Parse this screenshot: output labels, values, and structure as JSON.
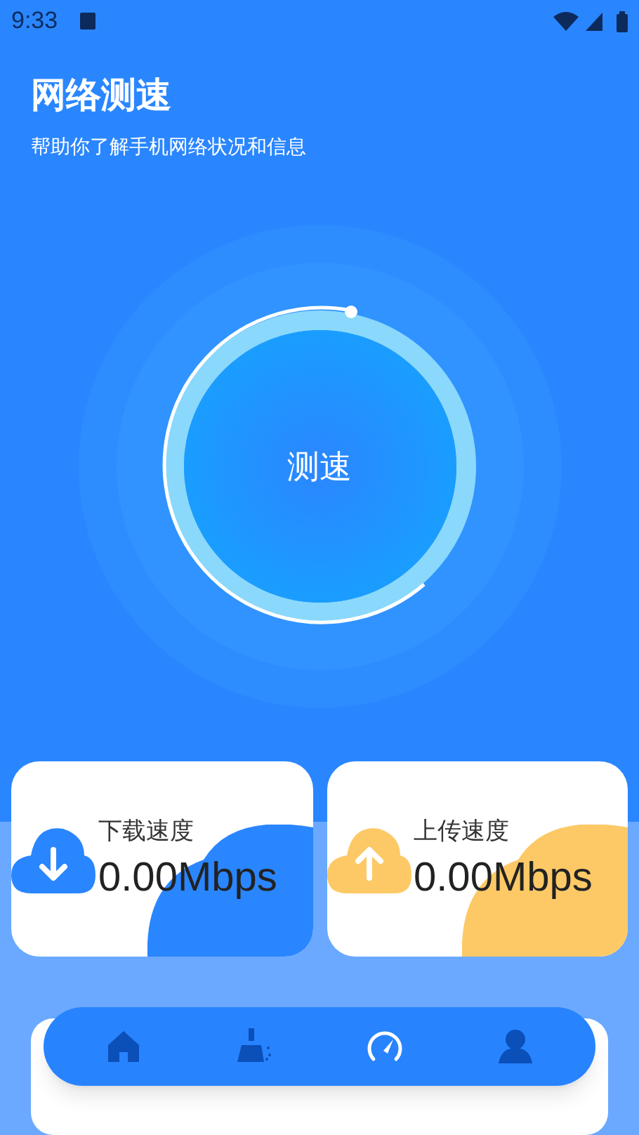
{
  "status_bar": {
    "time": "9:33"
  },
  "header": {
    "title": "网络测速",
    "subtitle": "帮助你了解手机网络状况和信息"
  },
  "test_button": {
    "label": "测速"
  },
  "cards": [
    {
      "kind": "download",
      "label": "下载速度",
      "value": "0.00Mbps"
    },
    {
      "kind": "upload",
      "label": "上传速度",
      "value": "0.00Mbps"
    }
  ],
  "nav": [
    {
      "kind": "home",
      "selected": false
    },
    {
      "kind": "clean",
      "selected": false
    },
    {
      "kind": "speed",
      "selected": true
    },
    {
      "kind": "profile",
      "selected": false
    }
  ]
}
